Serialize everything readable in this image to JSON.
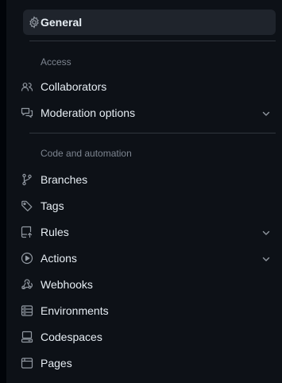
{
  "nav": {
    "general": {
      "label": "General",
      "icon": "gear-icon"
    },
    "access": {
      "heading": "Access",
      "items": [
        {
          "label": "Collaborators",
          "icon": "people-icon"
        },
        {
          "label": "Moderation options",
          "icon": "comment-discussion-icon",
          "expandable": true
        }
      ]
    },
    "code_automation": {
      "heading": "Code and automation",
      "items": [
        {
          "label": "Branches",
          "icon": "git-branch-icon"
        },
        {
          "label": "Tags",
          "icon": "tag-icon"
        },
        {
          "label": "Rules",
          "icon": "repo-push-icon",
          "expandable": true
        },
        {
          "label": "Actions",
          "icon": "play-icon",
          "expandable": true
        },
        {
          "label": "Webhooks",
          "icon": "webhook-icon"
        },
        {
          "label": "Environments",
          "icon": "server-icon"
        },
        {
          "label": "Codespaces",
          "icon": "codespaces-icon"
        },
        {
          "label": "Pages",
          "icon": "browser-icon"
        }
      ]
    }
  },
  "colors": {
    "background": "#0d1117",
    "active_bg": "#1f242c",
    "accent": "#2f81f7",
    "muted_text": "#7d8590",
    "divider": "#30363d"
  }
}
